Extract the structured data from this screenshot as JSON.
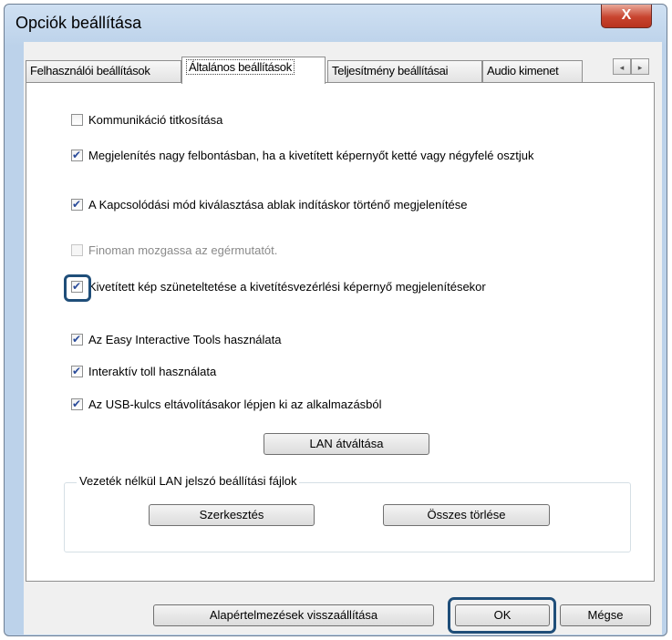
{
  "window": {
    "title": "Opciók beállítása",
    "close_label": "X"
  },
  "tabs": [
    {
      "label": "Felhasználói beállítások"
    },
    {
      "label": "Általános beállítások"
    },
    {
      "label": "Teljesítmény beállításai"
    },
    {
      "label": "Audio kimenet"
    }
  ],
  "tab_scroll": {
    "left": "◂",
    "right": "▸"
  },
  "options": [
    {
      "label": "Kommunikáció titkosítása",
      "checked": false,
      "enabled": true
    },
    {
      "label": "Megjelenítés nagy felbontásban, ha a kivetített képernyőt ketté vagy négyfelé osztjuk",
      "checked": true,
      "enabled": true
    },
    {
      "label": "A Kapcsolódási mód kiválasztása ablak indításkor történő megjelenítése",
      "checked": true,
      "enabled": true
    },
    {
      "label": "Finoman mozgassa az egérmutatót.",
      "checked": false,
      "enabled": false
    },
    {
      "label": "Kivetített kép szüneteltetése a kivetítésvezérlési képernyő megjelenítésekor",
      "checked": true,
      "enabled": true
    },
    {
      "label": "Az Easy Interactive Tools használata",
      "checked": true,
      "enabled": true
    },
    {
      "label": "Interaktív toll használata",
      "checked": true,
      "enabled": true
    },
    {
      "label": "Az USB-kulcs eltávolításakor lépjen ki az alkalmazásból",
      "checked": true,
      "enabled": true
    }
  ],
  "lan_button": "LAN átváltása",
  "wireless_group": {
    "label": "Vezeték nélkül LAN jelszó beállítási fájlok",
    "edit_button": "Szerkesztés",
    "delete_all_button": "Összes törlése"
  },
  "footer": {
    "restore_defaults_button": "Alapértelmezések visszaállítása",
    "ok_button": "OK",
    "cancel_button": "Mégse"
  },
  "colors": {
    "highlight": "#1f4e79",
    "check": "#2a4b9a"
  }
}
